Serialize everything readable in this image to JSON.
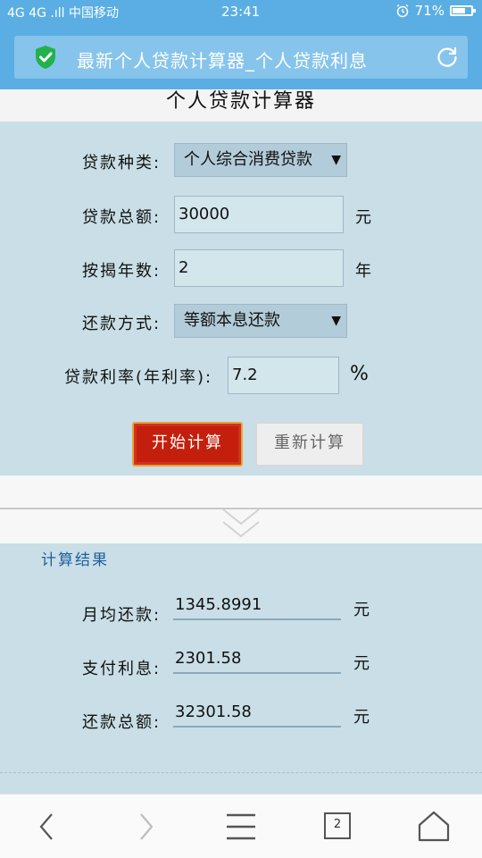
{
  "status_bar": {
    "signal": "4G 4G .ıll 中国移动",
    "time": "23:41",
    "alarm_icon": "alarm-clock-icon",
    "battery_level": "71%",
    "battery_fraction": 0.71
  },
  "browser": {
    "page_title": "最新个人贷款计算器_个人贷款利息",
    "secure_icon": "shield-check-icon",
    "refresh_icon": "refresh-icon",
    "accent_color": "#5aaee3"
  },
  "page": {
    "heading": "个人贷款计算器"
  },
  "form": {
    "loan_type_label": "贷款种类:",
    "loan_type_value": "个人综合消费贷款",
    "loan_amount_label": "贷款总额:",
    "loan_amount_value": "30000",
    "loan_amount_unit": "元",
    "years_label": "按揭年数:",
    "years_value": "2",
    "years_unit": "年",
    "repay_method_label": "还款方式:",
    "repay_method_value": "等额本息还款",
    "rate_label": "贷款利率(年利率):",
    "rate_value": "7.2",
    "rate_unit": "%",
    "start_button": "开始计算",
    "reset_button": "重新计算"
  },
  "result": {
    "title": "计算结果",
    "monthly_label": "月均还款:",
    "monthly_value": "1345.8991",
    "monthly_unit": "元",
    "interest_label": "支付利息:",
    "interest_value": "2301.58",
    "interest_unit": "元",
    "total_label": "还款总额:",
    "total_value": "32301.58",
    "total_unit": "元"
  },
  "bottom_nav": {
    "tab_count": "2"
  }
}
